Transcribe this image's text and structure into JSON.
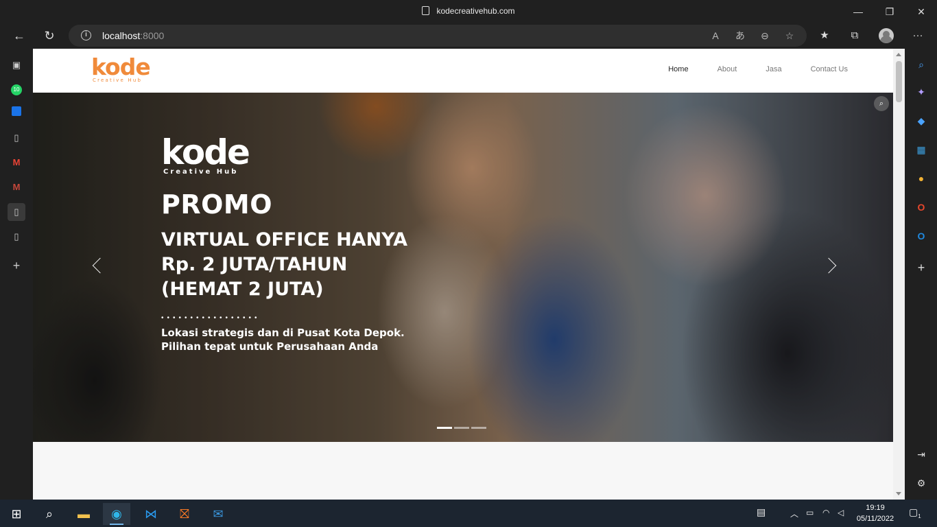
{
  "window": {
    "title": "kodecreativehub.com",
    "minimize": "—",
    "maximize": "❐",
    "close": "✕"
  },
  "address_bar": {
    "url_host": "localhost",
    "url_port": ":8000",
    "back": "←",
    "refresh": "↻",
    "info": "i"
  },
  "toolbar": {
    "read_aloud": "A",
    "translate": "あ",
    "zoom": "⊖",
    "add_favorite": "☆",
    "favorites": "★",
    "collections": "⧉",
    "more": "···"
  },
  "site": {
    "logo": {
      "word": "kode",
      "sub": "Creative Hub"
    },
    "menu": [
      {
        "label": "Home",
        "active": true
      },
      {
        "label": "About",
        "active": false
      },
      {
        "label": "Jasa",
        "active": false
      },
      {
        "label": "Contact Us",
        "active": false
      }
    ]
  },
  "hero": {
    "logo": {
      "word": "kode",
      "sub": "Creative Hub"
    },
    "promo": "PROMO",
    "headline": "VIRTUAL OFFICE HANYA\nRp. 2 JUTA/TAHUN\n(HEMAT 2 JUTA)",
    "dots": "•••••••••••••••••",
    "description": "Lokasi strategis dan di Pusat Kota Depok.\nPilihan tepat untuk Perusahaan Anda",
    "slide_count": 3,
    "active_slide": 1
  },
  "sidebar_left": {
    "whatsapp_badge": "10"
  },
  "taskbar": {
    "time": "19:19",
    "date": "05/11/2022",
    "notifications": "1"
  },
  "colors": {
    "brand_orange": "#f08a3a",
    "chrome_dark": "#202020",
    "taskbar": "#1c2530"
  }
}
